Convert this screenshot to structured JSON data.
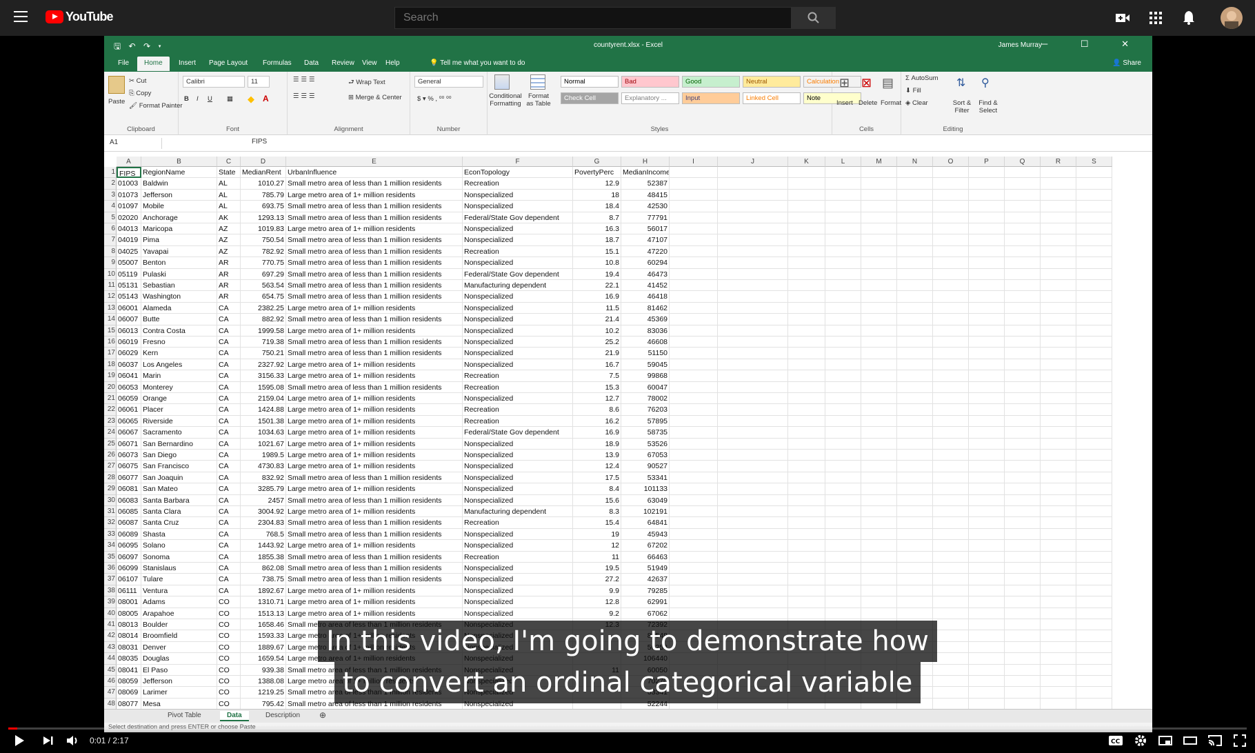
{
  "youtube": {
    "logo_text": "YouTube",
    "search_placeholder": "Search",
    "icons": [
      "menu-icon",
      "create-video-icon",
      "apps-icon",
      "notifications-icon",
      "avatar"
    ]
  },
  "excel": {
    "file_title": "countyrent.xlsx - Excel",
    "user": "James Murray",
    "share": "Share",
    "tell_me": "Tell me what you want to do",
    "tabs": [
      "File",
      "Home",
      "Insert",
      "Page Layout",
      "Formulas",
      "Data",
      "Review",
      "View",
      "Help"
    ],
    "active_tab": "Home",
    "ribbon": {
      "clipboard": {
        "paste": "Paste",
        "cut": "Cut",
        "copy": "Copy",
        "format_painter": "Format Painter",
        "label": "Clipboard"
      },
      "font": {
        "name": "Calibri",
        "size": "11",
        "label": "Font"
      },
      "alignment": {
        "wrap": "Wrap Text",
        "merge": "Merge & Center",
        "label": "Alignment"
      },
      "number": {
        "format": "General",
        "label": "Number"
      },
      "styles": {
        "conditional": "Conditional Formatting",
        "format_table": "Format as Table",
        "boxes": [
          {
            "label": "Normal",
            "bg": "#ffffff",
            "fg": "#000000"
          },
          {
            "label": "Bad",
            "bg": "#ffc7ce",
            "fg": "#9c0006"
          },
          {
            "label": "Good",
            "bg": "#c6efce",
            "fg": "#006100"
          },
          {
            "label": "Neutral",
            "bg": "#ffeb9c",
            "fg": "#9c5700"
          },
          {
            "label": "Calculation",
            "bg": "#f2f2f2",
            "fg": "#fa7d00"
          },
          {
            "label": "Check Cell",
            "bg": "#a5a5a5",
            "fg": "#ffffff"
          },
          {
            "label": "Explanatory ...",
            "bg": "#ffffff",
            "fg": "#7f7f7f"
          },
          {
            "label": "Input",
            "bg": "#ffcc99",
            "fg": "#3f3f76"
          },
          {
            "label": "Linked Cell",
            "bg": "#ffffff",
            "fg": "#fa7d00"
          },
          {
            "label": "Note",
            "bg": "#ffffcc",
            "fg": "#000000"
          }
        ],
        "label": "Styles"
      },
      "cells": {
        "insert": "Insert",
        "delete": "Delete",
        "format": "Format",
        "label": "Cells"
      },
      "editing": {
        "autosum": "AutoSum",
        "fill": "Fill",
        "clear": "Clear",
        "sort": "Sort & Filter",
        "find": "Find & Select",
        "label": "Editing"
      }
    },
    "name_box": "A1",
    "formula_value": "FIPS",
    "columns": [
      "A",
      "B",
      "C",
      "D",
      "E",
      "F",
      "G",
      "H",
      "I",
      "J",
      "K",
      "L",
      "M",
      "N",
      "O",
      "P",
      "Q",
      "R",
      "S"
    ],
    "headers": [
      "FIPS",
      "RegionName",
      "State",
      "MedianRent",
      "UrbanInfluence",
      "EconTopology",
      "PovertyPerc",
      "MedianIncome"
    ],
    "rows": [
      [
        "01003",
        "Baldwin",
        "AL",
        "1010.27",
        "Small metro area of less than 1 million residents",
        "Recreation",
        "12.9",
        "52387"
      ],
      [
        "01073",
        "Jefferson",
        "AL",
        "785.79",
        "Large metro area of 1+ million residents",
        "Nonspecialized",
        "18",
        "48415"
      ],
      [
        "01097",
        "Mobile",
        "AL",
        "693.75",
        "Small metro area of less than 1 million residents",
        "Nonspecialized",
        "18.4",
        "42530"
      ],
      [
        "02020",
        "Anchorage",
        "AK",
        "1293.13",
        "Small metro area of less than 1 million residents",
        "Federal/State Gov dependent",
        "8.7",
        "77791"
      ],
      [
        "04013",
        "Maricopa",
        "AZ",
        "1019.83",
        "Large metro area of 1+ million residents",
        "Nonspecialized",
        "16.3",
        "56017"
      ],
      [
        "04019",
        "Pima",
        "AZ",
        "750.54",
        "Small metro area of less than 1 million residents",
        "Nonspecialized",
        "18.7",
        "47107"
      ],
      [
        "04025",
        "Yavapai",
        "AZ",
        "782.92",
        "Small metro area of less than 1 million residents",
        "Recreation",
        "15.1",
        "47220"
      ],
      [
        "05007",
        "Benton",
        "AR",
        "770.75",
        "Small metro area of less than 1 million residents",
        "Nonspecialized",
        "10.8",
        "60294"
      ],
      [
        "05119",
        "Pulaski",
        "AR",
        "697.29",
        "Small metro area of less than 1 million residents",
        "Federal/State Gov dependent",
        "19.4",
        "46473"
      ],
      [
        "05131",
        "Sebastian",
        "AR",
        "563.54",
        "Small metro area of less than 1 million residents",
        "Manufacturing dependent",
        "22.1",
        "41452"
      ],
      [
        "05143",
        "Washington",
        "AR",
        "654.75",
        "Small metro area of less than 1 million residents",
        "Nonspecialized",
        "16.9",
        "46418"
      ],
      [
        "06001",
        "Alameda",
        "CA",
        "2382.25",
        "Large metro area of 1+ million residents",
        "Nonspecialized",
        "11.5",
        "81462"
      ],
      [
        "06007",
        "Butte",
        "CA",
        "882.92",
        "Small metro area of less than 1 million residents",
        "Nonspecialized",
        "21.4",
        "45369"
      ],
      [
        "06013",
        "Contra Costa",
        "CA",
        "1999.58",
        "Large metro area of 1+ million residents",
        "Nonspecialized",
        "10.2",
        "83036"
      ],
      [
        "06019",
        "Fresno",
        "CA",
        "719.38",
        "Small metro area of less than 1 million residents",
        "Nonspecialized",
        "25.2",
        "46608"
      ],
      [
        "06029",
        "Kern",
        "CA",
        "750.21",
        "Small metro area of less than 1 million residents",
        "Nonspecialized",
        "21.9",
        "51150"
      ],
      [
        "06037",
        "Los Angeles",
        "CA",
        "2327.92",
        "Large metro area of 1+ million residents",
        "Nonspecialized",
        "16.7",
        "59045"
      ],
      [
        "06041",
        "Marin",
        "CA",
        "3156.33",
        "Large metro area of 1+ million residents",
        "Recreation",
        "7.5",
        "99868"
      ],
      [
        "06053",
        "Monterey",
        "CA",
        "1595.08",
        "Small metro area of less than 1 million residents",
        "Recreation",
        "15.3",
        "60047"
      ],
      [
        "06059",
        "Orange",
        "CA",
        "2159.04",
        "Large metro area of 1+ million residents",
        "Nonspecialized",
        "12.7",
        "78002"
      ],
      [
        "06061",
        "Placer",
        "CA",
        "1424.88",
        "Large metro area of 1+ million residents",
        "Recreation",
        "8.6",
        "76203"
      ],
      [
        "06065",
        "Riverside",
        "CA",
        "1501.38",
        "Large metro area of 1+ million residents",
        "Recreation",
        "16.2",
        "57895"
      ],
      [
        "06067",
        "Sacramento",
        "CA",
        "1034.63",
        "Large metro area of 1+ million residents",
        "Federal/State Gov dependent",
        "16.9",
        "58735"
      ],
      [
        "06071",
        "San Bernardino",
        "CA",
        "1021.67",
        "Large metro area of 1+ million residents",
        "Nonspecialized",
        "18.9",
        "53526"
      ],
      [
        "06073",
        "San Diego",
        "CA",
        "1989.5",
        "Large metro area of 1+ million residents",
        "Nonspecialized",
        "13.9",
        "67053"
      ],
      [
        "06075",
        "San Francisco",
        "CA",
        "4730.83",
        "Large metro area of 1+ million residents",
        "Nonspecialized",
        "12.4",
        "90527"
      ],
      [
        "06077",
        "San Joaquin",
        "CA",
        "832.92",
        "Small metro area of less than 1 million residents",
        "Nonspecialized",
        "17.5",
        "53341"
      ],
      [
        "06081",
        "San Mateo",
        "CA",
        "3285.79",
        "Large metro area of 1+ million residents",
        "Nonspecialized",
        "8.4",
        "101133"
      ],
      [
        "06083",
        "Santa Barbara",
        "CA",
        "2457",
        "Small metro area of less than 1 million residents",
        "Nonspecialized",
        "15.6",
        "63049"
      ],
      [
        "06085",
        "Santa Clara",
        "CA",
        "3004.92",
        "Large metro area of 1+ million residents",
        "Manufacturing dependent",
        "8.3",
        "102191"
      ],
      [
        "06087",
        "Santa Cruz",
        "CA",
        "2304.83",
        "Small metro area of less than 1 million residents",
        "Recreation",
        "15.4",
        "64841"
      ],
      [
        "06089",
        "Shasta",
        "CA",
        "768.5",
        "Small metro area of less than 1 million residents",
        "Nonspecialized",
        "19",
        "45943"
      ],
      [
        "06095",
        "Solano",
        "CA",
        "1443.92",
        "Large metro area of 1+ million residents",
        "Nonspecialized",
        "12",
        "67202"
      ],
      [
        "06097",
        "Sonoma",
        "CA",
        "1855.38",
        "Small metro area of less than 1 million residents",
        "Recreation",
        "11",
        "66463"
      ],
      [
        "06099",
        "Stanislaus",
        "CA",
        "862.08",
        "Small metro area of less than 1 million residents",
        "Nonspecialized",
        "19.5",
        "51949"
      ],
      [
        "06107",
        "Tulare",
        "CA",
        "738.75",
        "Small metro area of less than 1 million residents",
        "Nonspecialized",
        "27.2",
        "42637"
      ],
      [
        "06111",
        "Ventura",
        "CA",
        "1892.67",
        "Large metro area of 1+ million residents",
        "Nonspecialized",
        "9.9",
        "79285"
      ],
      [
        "08001",
        "Adams",
        "CO",
        "1310.71",
        "Large metro area of 1+ million residents",
        "Nonspecialized",
        "12.8",
        "62991"
      ],
      [
        "08005",
        "Arapahoe",
        "CO",
        "1513.13",
        "Large metro area of 1+ million residents",
        "Nonspecialized",
        "9.2",
        "67062"
      ],
      [
        "08013",
        "Boulder",
        "CO",
        "1658.46",
        "Small metro area of less than 1 million residents",
        "Nonspecialized",
        "12.3",
        "72392"
      ],
      [
        "08014",
        "Broomfield",
        "CO",
        "1593.33",
        "Large metro area of 1+ million residents",
        "Nonspecialized",
        "",
        "82548"
      ],
      [
        "08031",
        "Denver",
        "CO",
        "1889.67",
        "Large metro area of 1+ million residents",
        "Nonspecialized",
        "",
        "56258"
      ],
      [
        "08035",
        "Douglas",
        "CO",
        "1659.54",
        "Large metro area of 1+ million residents",
        "Nonspecialized",
        "",
        "106440"
      ],
      [
        "08041",
        "El Paso",
        "CO",
        "939.38",
        "Small metro area of less than 1 million residents",
        "Nonspecialized",
        "11",
        "60050"
      ],
      [
        "08059",
        "Jefferson",
        "CO",
        "1388.08",
        "Large metro area of 1+ million residents",
        "Nonspecialized",
        "",
        "70270"
      ],
      [
        "08069",
        "Larimer",
        "CO",
        "1219.25",
        "Small metro area of less than 1 million residents",
        "Nonspecialized",
        "",
        "63341"
      ],
      [
        "08077",
        "Mesa",
        "CO",
        "795.42",
        "Small metro area of less than 1 million residents",
        "Nonspecialized",
        "",
        "52244"
      ]
    ],
    "sheet_tabs": [
      "Pivot Table",
      "Data",
      "Description"
    ],
    "active_sheet": "Data",
    "status": "Select destination and press ENTER or choose Paste"
  },
  "caption": {
    "line1": "In this video, I'm going to demonstrate how",
    "line2": "to convert an ordinal categorical variable"
  },
  "player": {
    "time": "0:01 / 2:17",
    "progress_fraction": 0.007
  }
}
